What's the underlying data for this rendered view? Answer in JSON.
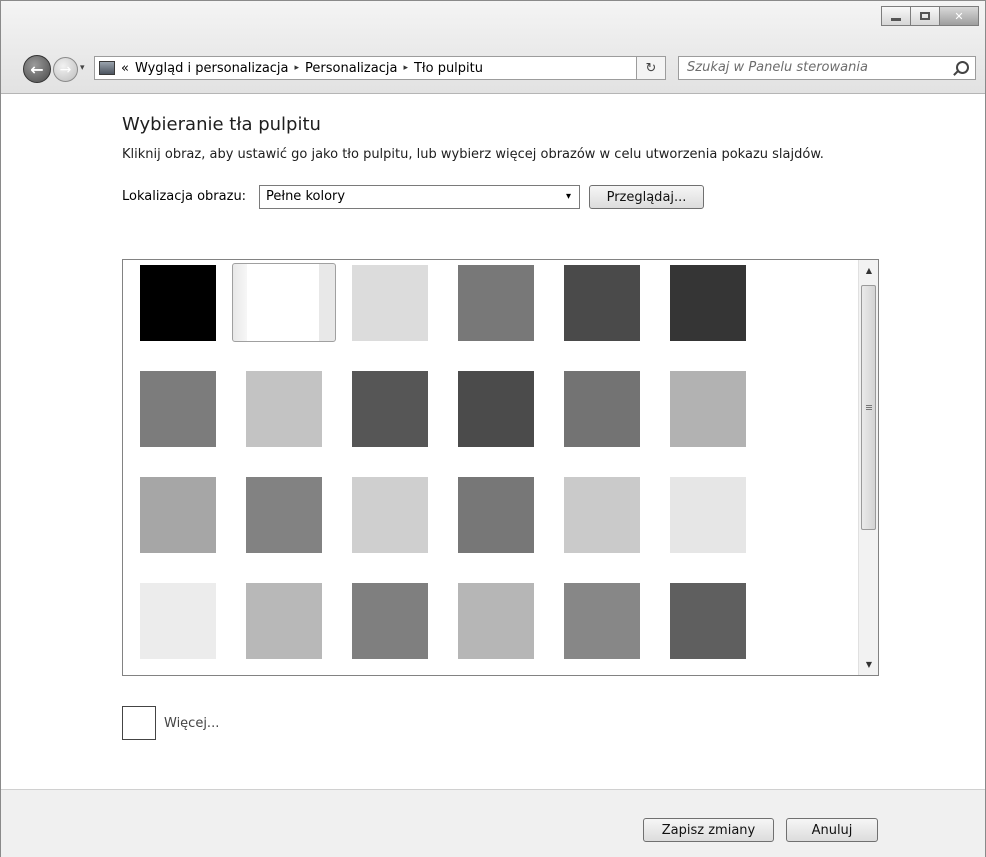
{
  "window": {
    "caption": {
      "minimize_icon": "minimize-icon",
      "maximize_icon": "maximize-icon",
      "close_icon": "close-icon",
      "close_glyph": "✕"
    }
  },
  "nav": {
    "back_glyph": "←",
    "forward_glyph": "→",
    "history_glyph": "▾"
  },
  "address": {
    "more": "«",
    "breadcrumbs": [
      "Wygląd i personalizacja",
      "Personalizacja",
      "Tło pulpitu"
    ],
    "separator": "▸",
    "dropdown_glyph": "▾",
    "refresh_glyph": "↻"
  },
  "search": {
    "placeholder": "Szukaj w Panelu sterowania"
  },
  "page": {
    "title": "Wybieranie tła pulpitu",
    "subtitle": "Kliknij obraz, aby ustawić go jako tło pulpitu, lub wybierz więcej obrazów w celu utworzenia pokazu slajdów.",
    "location_label": "Lokalizacja obrazu:",
    "location_value": "Pełne kolory",
    "location_arrow": "▾",
    "browse_button": "Przeglądaj..."
  },
  "gallery": {
    "selected_index": 1,
    "colors": [
      "#000000",
      "#ffffff",
      "#dcdcdc",
      "#787878",
      "#4a4a4a",
      "#353535",
      "#7c7c7c",
      "#c3c3c3",
      "#565656",
      "#4b4b4b",
      "#737373",
      "#b2b2b2",
      "#a6a6a6",
      "#828282",
      "#cfcfcf",
      "#777777",
      "#cacaca",
      "#e6e6e6",
      "#ececec",
      "#b8b8b8",
      "#7f7f7f",
      "#b6b6b6",
      "#878787",
      "#5f5f5f"
    ],
    "scroll_up_glyph": "▲",
    "scroll_down_glyph": "▼"
  },
  "more": {
    "label": "Więcej..."
  },
  "footer": {
    "save_button": "Zapisz zmiany",
    "cancel_button": "Anuluj"
  }
}
